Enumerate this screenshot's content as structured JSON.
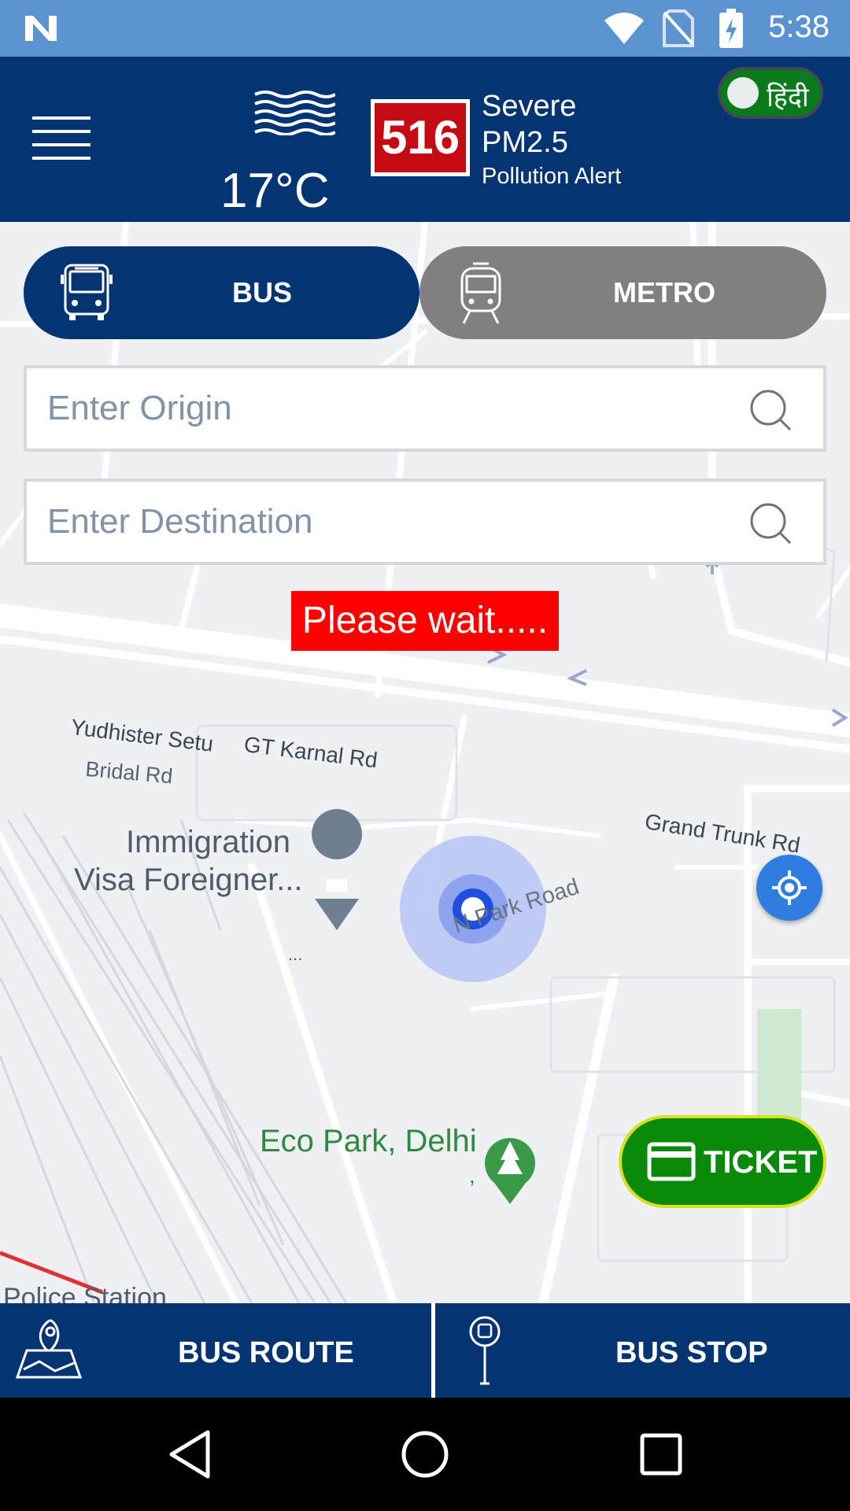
{
  "status_bar": {
    "time": "5:38"
  },
  "header": {
    "temperature": "17°C",
    "aqi_value": "516",
    "aqi_severity": "Severe",
    "aqi_pollutant": "PM2.5",
    "aqi_alert": "Pollution Alert",
    "language_toggle_label": "हिंदी"
  },
  "mode_tabs": [
    {
      "label": "BUS"
    },
    {
      "label": "METRO"
    }
  ],
  "search": {
    "origin_placeholder": "Enter Origin",
    "destination_placeholder": "Enter Destination"
  },
  "status_message": "Please wait.....",
  "map_labels": {
    "yudhister_setu": "Yudhister Setu",
    "gt_karnal_rd": "GT Karnal Rd",
    "bridal_rd": "Bridal Rd",
    "grand_trunk_rd": "Grand Trunk Rd",
    "immigration_line1": "Immigration",
    "immigration_line2": "Visa Foreigner...",
    "immigration_ellipsis": "...",
    "park_road": "N Park Road",
    "eco_park": "Eco Park, Delhi",
    "eco_park_sub": ",",
    "police_station": "Police Station"
  },
  "ticket_button": {
    "label": "TICKET"
  },
  "bottom_nav": {
    "bus_route": "BUS ROUTE",
    "bus_stop": "BUS STOP"
  },
  "colors": {
    "primary": "#053473",
    "inactive_tab": "#808080",
    "aqi_red": "#c40b14",
    "alert_red": "#ff0000",
    "ticket_green": "#0a8a0a",
    "location_blue": "#2f7de1"
  }
}
